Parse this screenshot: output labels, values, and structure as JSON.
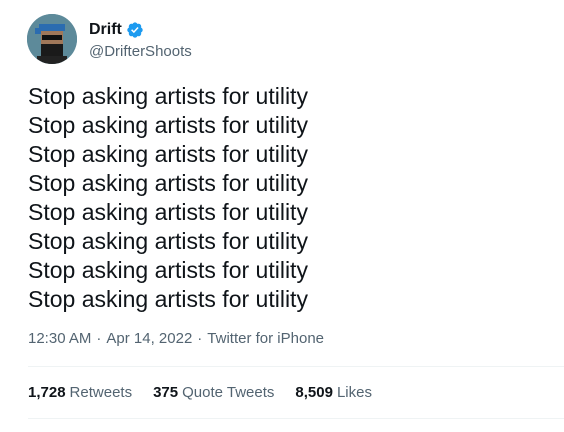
{
  "author": {
    "display_name": "Drift",
    "handle": "@DrifterShoots",
    "verified": true
  },
  "tweet": {
    "lines": [
      "Stop asking artists for utility",
      "Stop asking artists for utility",
      "Stop asking artists for utility",
      "Stop asking artists for utility",
      "Stop asking artists for utility",
      "Stop asking artists for utility",
      "Stop asking artists for utility",
      "Stop asking artists for utility"
    ]
  },
  "meta": {
    "time": "12:30 AM",
    "separator": "·",
    "date": "Apr 14, 2022",
    "source": "Twitter for iPhone"
  },
  "stats": [
    {
      "count": "1,728",
      "label": "Retweets"
    },
    {
      "count": "375",
      "label": "Quote Tweets"
    },
    {
      "count": "8,509",
      "label": "Likes"
    }
  ],
  "colors": {
    "text_primary": "#0f1419",
    "text_secondary": "#536471",
    "verified_blue": "#1d9bf0",
    "divider": "#eff3f4",
    "avatar_bg": "#5d8a9a"
  },
  "icons": {
    "verified": "verified-badge-icon"
  }
}
